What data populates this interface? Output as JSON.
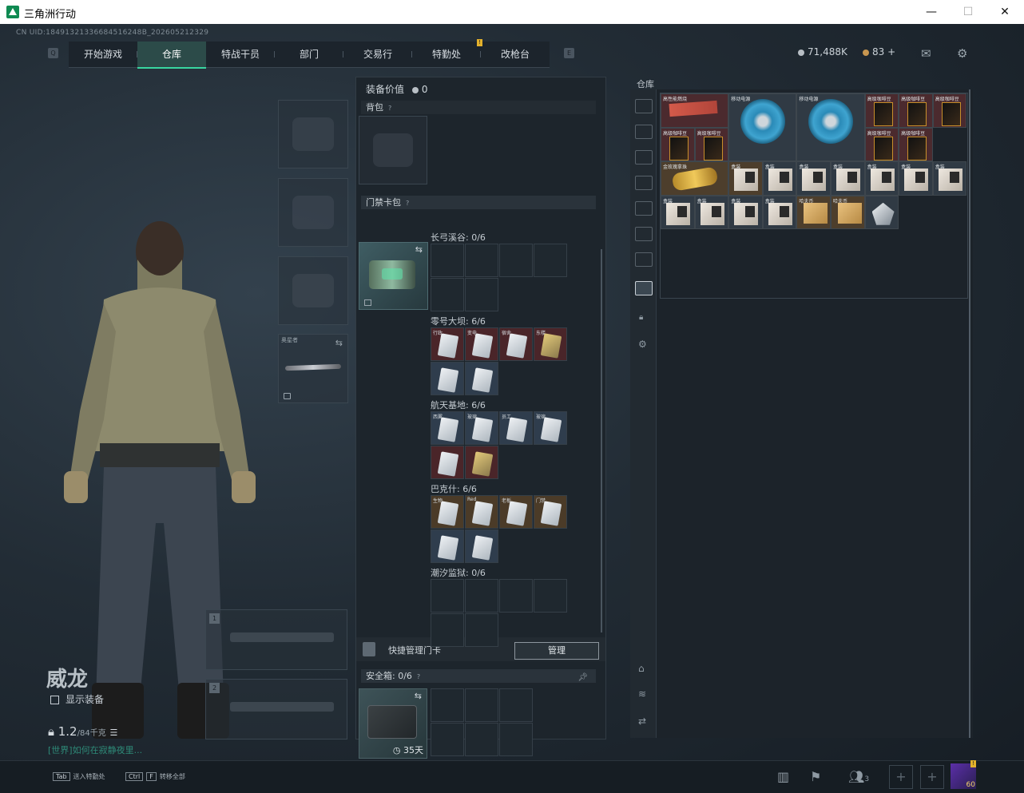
{
  "window": {
    "title": "三角洲行动",
    "minimize": "—",
    "maximize": "☐",
    "close": "✕"
  },
  "uid": "CN UID:18491321336684516248B_202605212329",
  "nav": {
    "left_key": "Q",
    "right_key": "E",
    "tabs": [
      "开始游戏",
      "仓库",
      "特战干员",
      "部门",
      "交易行",
      "特勤处",
      "改枪台"
    ],
    "active": "仓库",
    "badge": "!"
  },
  "currency": {
    "silver": "71,488K",
    "gold": "83",
    "add": "+"
  },
  "equipment": {
    "knife_label": "奥星者",
    "character_name": "威龙",
    "show_gear": "显示装备",
    "weight_value": "1.2",
    "weight_unit": "/84千克",
    "chat": "[世界]如何在寂静夜里...",
    "weapon_slot_1": "1",
    "weapon_slot_2": "2"
  },
  "loadout": {
    "value_label": "装备价值",
    "value": "0",
    "backpack": "背包",
    "keycard_header": "门禁卡包",
    "help": "?",
    "groups": [
      {
        "label": "长弓溪谷: 0/6"
      },
      {
        "label": "零号大坝: 6/6",
        "cards": [
          "行政",
          "变电",
          "宿舍",
          "东楼",
          "",
          ""
        ]
      },
      {
        "label": "航天基地: 6/6",
        "cards": [
          "西翼",
          "玻璃",
          "员工",
          "玻璃",
          "",
          ""
        ]
      },
      {
        "label": "巴克什: 6/6",
        "cards": [
          "生物",
          "Red",
          "老板",
          "门禁",
          "",
          ""
        ]
      },
      {
        "label": "潮汐监狱: 0/6"
      }
    ],
    "quick_manage": "快捷管理门卡",
    "manage_button": "管理",
    "safebox_label": "安全箱:",
    "safebox_count": "0/6",
    "safebox_days": "35天"
  },
  "warehouse": {
    "label": "仓库",
    "items": [
      {
        "t": "高性能燃烧",
        "c": "red",
        "k": "bar",
        "w": 2,
        "h": 1
      },
      {
        "t": "移动电源",
        "c": "gray",
        "k": "reel",
        "w": 2,
        "h": 2
      },
      {
        "t": "移动电源",
        "c": "gray",
        "k": "reel",
        "w": 2,
        "h": 2
      },
      {
        "t": "高级咖啡豆",
        "c": "red",
        "k": "pkg",
        "w": 1,
        "h": 1
      },
      {
        "t": "高级咖啡豆",
        "c": "red",
        "k": "pkg",
        "w": 1,
        "h": 1
      },
      {
        "t": "高级咖啡豆",
        "c": "red",
        "k": "pkg",
        "w": 1,
        "h": 1
      },
      {
        "t": "高级咖啡豆",
        "c": "red",
        "k": "pkg",
        "w": 1,
        "h": 1
      },
      {
        "t": "高级咖啡豆",
        "c": "red",
        "k": "pkg",
        "w": 1,
        "h": 1
      },
      {
        "t": "高级咖啡豆",
        "c": "red",
        "k": "pkg",
        "w": 1,
        "h": 1
      },
      {
        "t": "高级咖啡豆",
        "c": "red",
        "k": "pkg",
        "w": 1,
        "h": 1
      },
      {
        "t": "金玫瑰拿珠",
        "c": "gold",
        "k": "rose",
        "w": 2,
        "h": 1
      },
      {
        "t": "盒装",
        "c": "gold",
        "k": "box",
        "w": 1,
        "h": 1
      },
      {
        "t": "盒装",
        "c": "gray",
        "k": "box",
        "w": 1,
        "h": 1
      },
      {
        "t": "盒装",
        "c": "gray",
        "k": "box",
        "w": 1,
        "h": 1
      },
      {
        "t": "盒装",
        "c": "gray",
        "k": "box",
        "w": 1,
        "h": 1
      },
      {
        "t": "盒装",
        "c": "gray",
        "k": "box",
        "w": 1,
        "h": 1
      },
      {
        "t": "盒装",
        "c": "gray",
        "k": "box",
        "w": 1,
        "h": 1
      },
      {
        "t": "盒装",
        "c": "gray",
        "k": "box",
        "w": 1,
        "h": 1
      },
      {
        "t": "盒装",
        "c": "gray",
        "k": "box",
        "w": 1,
        "h": 1
      },
      {
        "t": "盒装",
        "c": "gray",
        "k": "box",
        "w": 1,
        "h": 1
      },
      {
        "t": "盒装",
        "c": "gray",
        "k": "box",
        "w": 1,
        "h": 1
      },
      {
        "t": "盒装",
        "c": "gray",
        "k": "box",
        "w": 1,
        "h": 1
      },
      {
        "t": "哈夫币",
        "c": "gold",
        "k": "scroll",
        "w": 1,
        "h": 1
      },
      {
        "t": "哈夫币",
        "c": "gold",
        "k": "scroll",
        "w": 1,
        "h": 1
      },
      {
        "t": "",
        "c": "gray",
        "k": "gem",
        "w": 1,
        "h": 1
      }
    ]
  },
  "bottom": {
    "tab_key": "Tab",
    "tab_hint": "送入特勤处",
    "ctrl_key": "Ctrl",
    "f_key": "F",
    "ctrl_hint": "转移全部",
    "team_count": "3",
    "level": "60"
  }
}
